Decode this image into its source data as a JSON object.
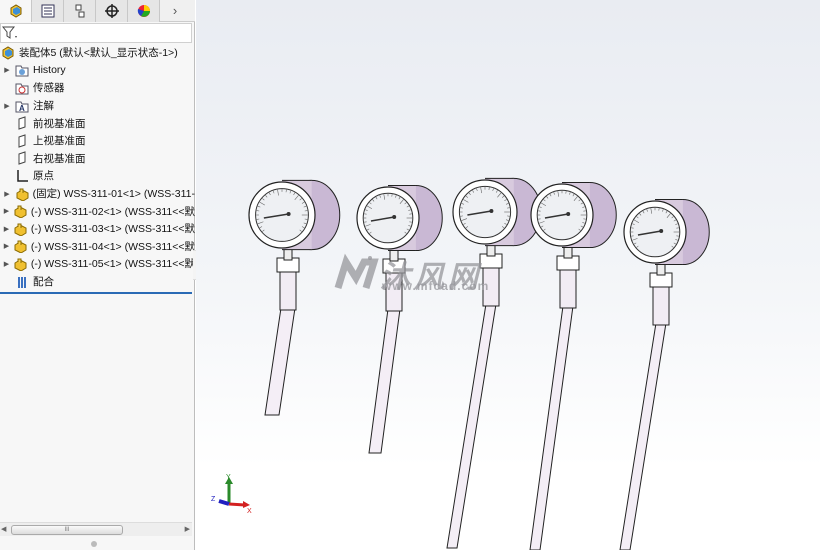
{
  "tabs": [
    {
      "name": "feature-manager",
      "icon": "assembly-icon"
    },
    {
      "name": "property-manager",
      "icon": "list-icon"
    },
    {
      "name": "configuration-manager",
      "icon": "config-icon"
    },
    {
      "name": "dimxpert-manager",
      "icon": "crosshair-icon"
    },
    {
      "name": "display-manager",
      "icon": "color-wheel-icon"
    }
  ],
  "tabs_more": "›",
  "filter_icon": "funnel-icon",
  "tree": {
    "root": "装配体5  (默认<默认_显示状态-1>)",
    "items": [
      {
        "label": "History",
        "icon": "history-folder-icon",
        "expandable": true
      },
      {
        "label": "传感器",
        "icon": "sensor-folder-icon",
        "expandable": false
      },
      {
        "label": "注解",
        "icon": "annotation-folder-icon",
        "expandable": true
      },
      {
        "label": "前视基准面",
        "icon": "plane-icon",
        "expandable": false
      },
      {
        "label": "上视基准面",
        "icon": "plane-icon",
        "expandable": false
      },
      {
        "label": "右视基准面",
        "icon": "plane-icon",
        "expandable": false
      },
      {
        "label": "原点",
        "icon": "origin-icon",
        "expandable": false
      },
      {
        "label": "(固定) WSS-311-01<1> (WSS-311-",
        "icon": "part-icon",
        "expandable": true
      },
      {
        "label": "(-) WSS-311-02<1> (WSS-311<<默",
        "icon": "part-icon",
        "expandable": true
      },
      {
        "label": "(-) WSS-311-03<1> (WSS-311<<默",
        "icon": "part-icon",
        "expandable": true
      },
      {
        "label": "(-) WSS-311-04<1> (WSS-311<<默",
        "icon": "part-icon",
        "expandable": true
      },
      {
        "label": "(-) WSS-311-05<1> (WSS-311<<默",
        "icon": "part-icon",
        "expandable": true
      },
      {
        "label": "配合",
        "icon": "mates-icon",
        "expandable": false
      }
    ]
  },
  "scroll_thumb": "III",
  "watermark": {
    "cn": "沐风网",
    "url": "www.mfcad.com"
  },
  "triad": {
    "x": "X",
    "y": "Y",
    "z": "Z",
    "colors": {
      "x": "#d32020",
      "y": "#2a8a2a",
      "z": "#2020c0"
    }
  }
}
